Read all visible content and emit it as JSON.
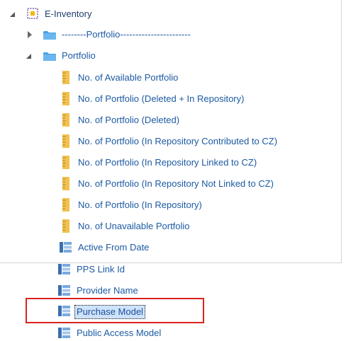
{
  "tree": {
    "root": {
      "label": "E-Inventory",
      "icon": "subject-area-cube-icon"
    },
    "folder_collapsed": {
      "label": "--------Portfolio-----------------------",
      "icon": "folder-icon"
    },
    "folder_expanded": {
      "label": "Portfolio",
      "icon": "folder-icon"
    },
    "measures": [
      {
        "label": "No. of Available Portfolio"
      },
      {
        "label": "No. of Portfolio (Deleted + In Repository)"
      },
      {
        "label": "No. of Portfolio (Deleted)"
      },
      {
        "label": "No. of Portfolio (In Repository Contributed to CZ)"
      },
      {
        "label": "No. of Portfolio (In Repository Linked to CZ)"
      },
      {
        "label": "No. of Portfolio (In Repository Not Linked to CZ)"
      },
      {
        "label": "No. of Portfolio (In Repository)"
      },
      {
        "label": "No. of Unavailable Portfolio"
      }
    ],
    "attributes": [
      {
        "label": "Active From Date"
      },
      {
        "label": "PPS Link Id"
      },
      {
        "label": "Provider Name"
      },
      {
        "label": "Purchase Model",
        "selected": true
      },
      {
        "label": "Public Access Model"
      }
    ]
  },
  "colors": {
    "link_text": "#1c5aa3",
    "selection_outline": "#d9231d",
    "selection_fill": "#cfe2fb",
    "folder": "#4a9fe0",
    "measure_icon": "#f2c14e",
    "attribute_icon": "#5b8fc9"
  }
}
